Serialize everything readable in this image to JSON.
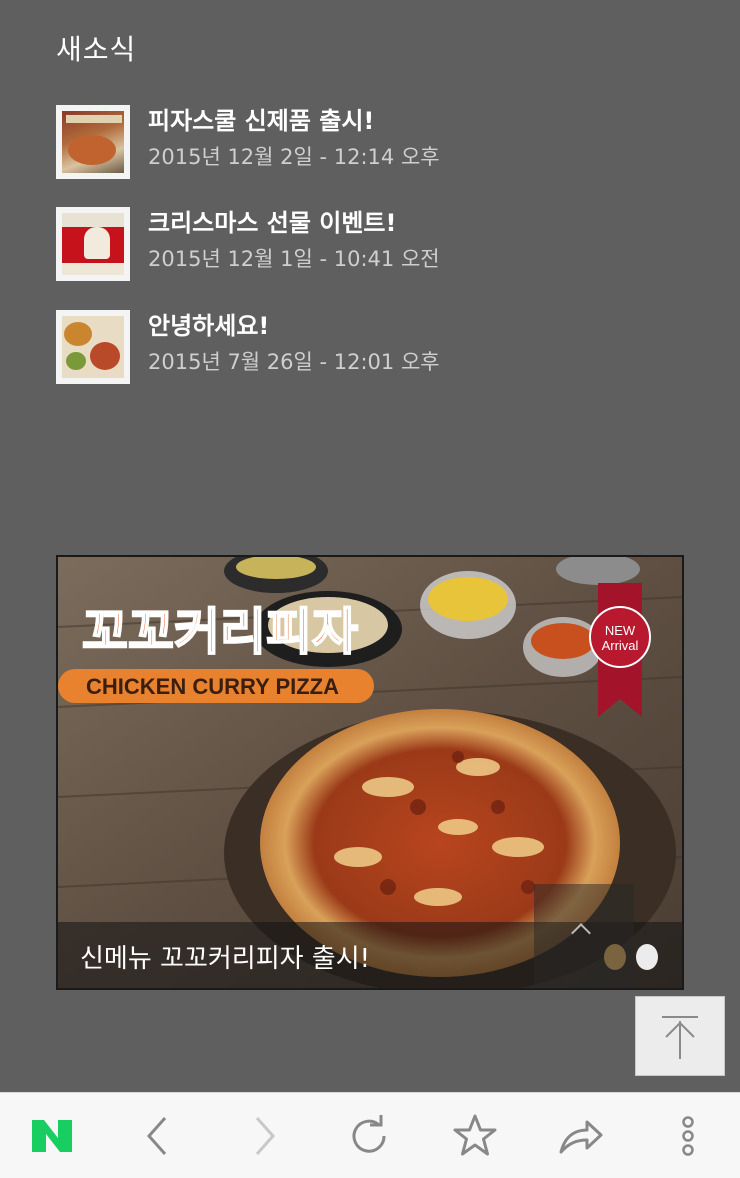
{
  "section": {
    "title": "새소식"
  },
  "news": [
    {
      "title": "피자스쿨 신제품 출시!",
      "date": "2015년 12월 2일 - 12:14 오후"
    },
    {
      "title": "크리스마스 선물 이벤트!",
      "date": "2015년 12월 1일 - 10:41 오전"
    },
    {
      "title": "안녕하세요!",
      "date": "2015년 7월 26일 - 12:01 오후"
    }
  ],
  "banner": {
    "caption": "신메뉴 꼬꼬커리피자 출시!",
    "image_title_ko": "꼬꼬커리피자",
    "image_title_en": "CHICKEN CURRY PIZZA",
    "ribbon_line1": "NEW",
    "ribbon_line2": "Arrival",
    "slide_count": 2,
    "active_slide": 2
  },
  "toolbar": {
    "icons": [
      "naver-logo-icon",
      "back-icon",
      "forward-icon",
      "refresh-icon",
      "bookmark-star-icon",
      "share-icon",
      "more-icon"
    ],
    "logo_letter": "N"
  },
  "colors": {
    "background": "#5f5f5f",
    "naver_green": "#19ce60",
    "toolbar_bg": "#f7f7f7",
    "icon_gray": "#888888"
  }
}
